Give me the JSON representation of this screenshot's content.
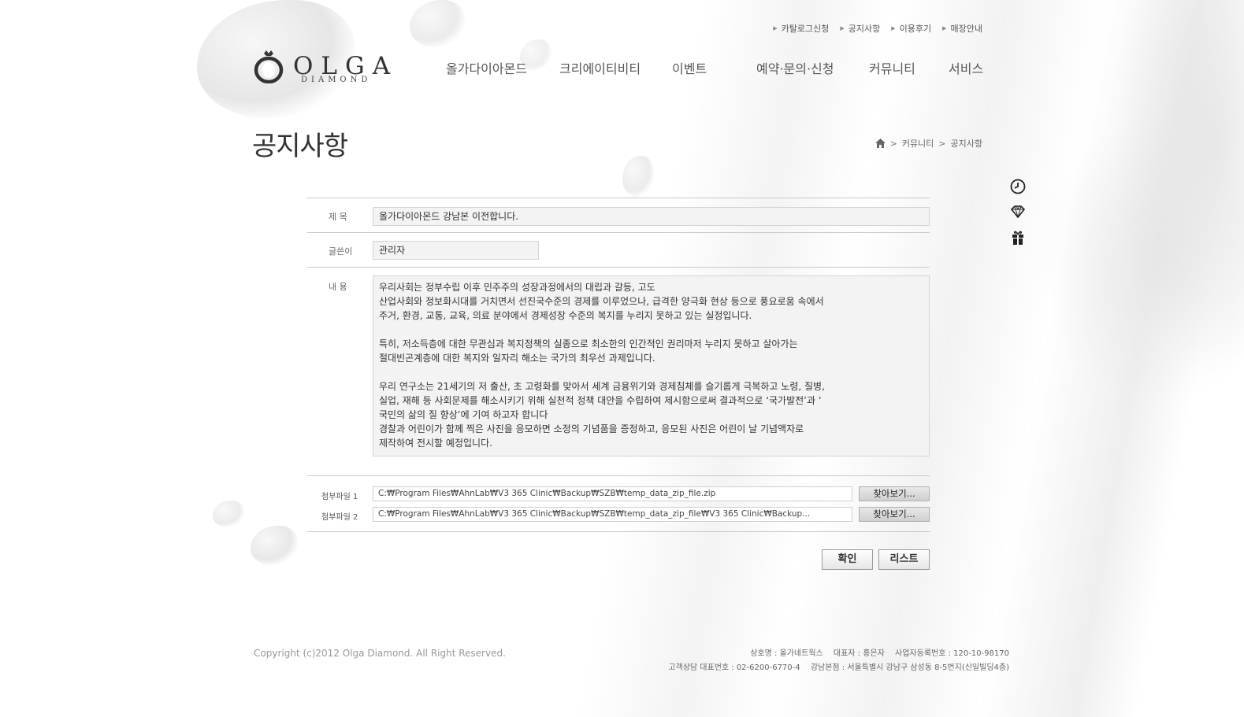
{
  "util_nav": [
    "카탈로그신청",
    "공지사항",
    "이용후기",
    "매장안내"
  ],
  "logo": {
    "name": "OLGA",
    "sub": "DIAMOND"
  },
  "main_nav": [
    "올가다이아몬드",
    "크리에이티비티",
    "이벤트",
    "예약·문의·신청",
    "커뮤니티",
    "서비스"
  ],
  "page_title": "공지사항",
  "breadcrumb": {
    "home_icon": "home-icon",
    "level1": "커뮤니티",
    "level2": "공지사항"
  },
  "quick_icons": [
    "clock-icon",
    "diamond-icon",
    "gift-icon"
  ],
  "form": {
    "subject_label": "제 목",
    "subject_value": "올가다이아몬드 강남본 이전합니다.",
    "writer_label": "글쓴이",
    "writer_value": "관리자",
    "content_label": "내 용",
    "content_lines": [
      "우리사회는 정부수립 이후 민주주의 성장과정에서의 대립과 갈등, 고도",
      "산업사회와 정보화시대를 거치면서 선진국수준의 경제를 이루었으나, 급격한 양극화 현상 등으로 풍요로움 속에서",
      "주거, 환경, 교통, 교육, 의료 분야에서 경제성장 수준의 복지를 누리지 못하고 있는 실정입니다.",
      "",
      "특히, 저소득층에 대한 무관심과 복지정책의 실종으로 최소한의 인간적인 권리마저 누리지 못하고 살아가는",
      "절대빈곤계층에 대한 복지와 일자리 해소는 국가의 최우선 과제입니다.",
      "",
      "우리 연구소는 21세기의 저 출산, 초 고령화를 맞아서 세계 금융위기와 경제침체를 슬기롭게 극복하고 노령, 질병,",
      "실업, 재해 등 사회문제를 해소시키기 위해 실천적 정책 대안을 수립하여 제시함으로써 결과적으로 ‘국가발전’과 ‘",
      "국민의 삶의 질 향상’에 기여 하고자 합니다",
      "경찰과 어린이가 함께 찍은 사진을 응모하면 소정의 기념품을 증정하고, 응모된 사진은 어린이 날 기념액자로",
      "제작하여 전시할 예정입니다."
    ],
    "file1_label": "첨부파일 1",
    "file1_value": "C:₩Program Files₩AhnLab₩V3 365 Clinic₩Backup₩SZB₩temp_data_zip_file.zip",
    "file2_label": "첨부파일 2",
    "file2_value": "C:₩Program Files₩AhnLab₩V3 365 Clinic₩Backup₩SZB₩temp_data_zip_file₩V3 365 Clinic₩Backup...",
    "browse_label": "찾아보기...",
    "ok_label": "확인",
    "list_label": "리스트"
  },
  "footer": {
    "copyright": "Copyright (c)2012 Olga Diamond. All Right Reserved.",
    "company_name": "상호명 : 올가네트웍스",
    "ceo": "대표자 : 홍은자",
    "biz_no": "사업자등록번호 : 120-10-98170",
    "phone": "고객상담 대표번호 : 02-6200-6770-4",
    "address": "강남본점 : 서울특별시 강남구 삼성동 8-5번지(신일빌딩4층)"
  },
  "colors": {
    "text": "#444444",
    "border": "#c9c9c9",
    "box_bg": "#f3f3f3"
  }
}
